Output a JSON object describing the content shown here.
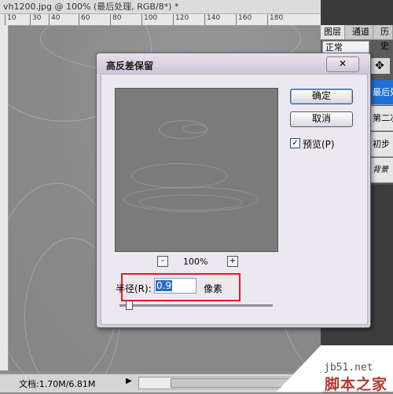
{
  "window": {
    "title": "vh1200.jpg @ 100% (最后处理, RGB/8*) *",
    "close": "×"
  },
  "ruler": {
    "ticks": [
      "10",
      "30",
      "40",
      "60",
      "80",
      "100",
      "120",
      "140",
      "160",
      "180"
    ]
  },
  "status": {
    "doc_size": "文档:1.70M/6.81M",
    "arrow": "▶"
  },
  "panel": {
    "tabs": [
      "图层",
      "通道",
      "历史"
    ],
    "blend_mode": "正常",
    "move_icon": "move-icon",
    "layers": [
      "最后处",
      "第二次",
      "初步",
      "背景"
    ]
  },
  "dialog": {
    "title": "高反差保留",
    "close": "✕",
    "ok_label": "确定",
    "cancel_label": "取消",
    "preview_label": "预览(P)",
    "preview_checked": true,
    "zoom_out": "-",
    "zoom_in": "+",
    "zoom_level": "100%",
    "radius_label": "半径(R):",
    "radius_value": "0.9",
    "radius_unit": "像素",
    "slider_value": 0.9
  },
  "watermark": {
    "url": "jb51.net",
    "name": "脚本之家"
  },
  "colors": {
    "selected_layer": "#1e6fd8",
    "highlight": "#e8181e",
    "dialog_bg": "#d6cfdc"
  }
}
